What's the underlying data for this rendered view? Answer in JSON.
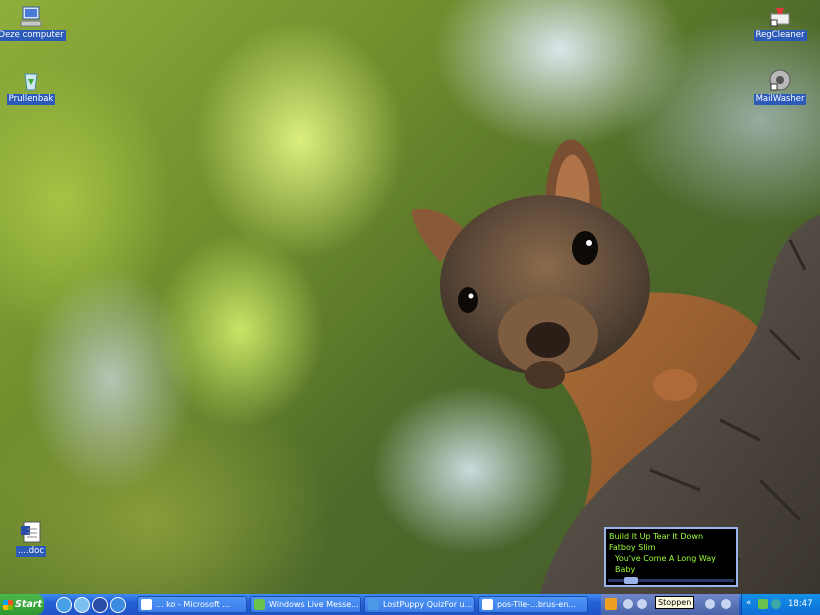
{
  "desktop": {
    "icons": [
      {
        "label": "Deze computer",
        "icon": "my-computer-icon"
      },
      {
        "label": "Prullenbak",
        "icon": "recycle-bin-icon"
      },
      {
        "label": "RegCleaner",
        "icon": "regcleaner-icon"
      },
      {
        "label": "MailWasher",
        "icon": "mailwasher-icon"
      },
      {
        "label": "....doc",
        "icon": "word-document-icon"
      }
    ]
  },
  "media_player": {
    "track_title": "Build It Up Tear It Down",
    "artist": "Fatboy Slim",
    "album": "You've Come A Long Way Baby",
    "tooltip": "Stoppen"
  },
  "taskbar": {
    "start_label": "Start",
    "quick_launch": [
      "internet-explorer-icon",
      "outlook-express-icon",
      "media-player-icon",
      "ie-globe-icon"
    ],
    "buttons": [
      {
        "label": "... ko - Microsoft ...",
        "icon": "word-icon"
      },
      {
        "label": "Windows Live Messe...",
        "icon": "messenger-icon"
      },
      {
        "label": "LostPuppy QuizFor u...",
        "icon": "ie-icon"
      },
      {
        "label": "pos-Tile-...brus-en...",
        "icon": "document-icon"
      }
    ],
    "tray_clock": "18:47",
    "tray_expand": "«"
  },
  "colors": {
    "taskbar": "#2461d5",
    "start": "#2f972f",
    "tray": "#0d6fd6",
    "label_bg": "#2b5ab8"
  }
}
